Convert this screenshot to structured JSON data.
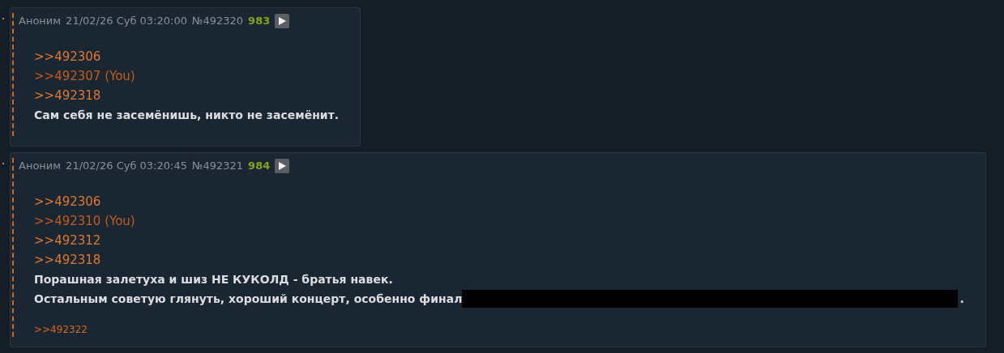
{
  "posts": [
    {
      "header": {
        "author": "Аноним",
        "date": "21/02/26 Суб 03:20:00",
        "number": "№492320",
        "index": "983"
      },
      "replies": [
        {
          "text": ">>492306",
          "you": false
        },
        {
          "text": ">>492307 (You)",
          "you": true
        },
        {
          "text": ">>492318",
          "you": false
        }
      ],
      "lines": [
        {
          "text": "Сам себя не засемёнишь, никто не засемёнит.",
          "spoiler": false
        }
      ]
    },
    {
      "header": {
        "author": "Аноним",
        "date": "21/02/26 Суб 03:20:45",
        "number": "№492321",
        "index": "984"
      },
      "replies": [
        {
          "text": ">>492306",
          "you": false
        },
        {
          "text": ">>492310 (You)",
          "you": true
        },
        {
          "text": ">>492312",
          "you": false
        },
        {
          "text": ">>492318",
          "you": false
        }
      ],
      "lines": [
        {
          "text": "Порашная залетуха и шиз **НЕ КУКОЛД** - братья навек.",
          "spoiler": false
        },
        {
          "text": "Остальным советую глянуть, хороший концерт, особенно финал",
          "spoiler": true,
          "tail": "."
        }
      ],
      "backlinks": [
        ">>492322"
      ]
    }
  ]
}
